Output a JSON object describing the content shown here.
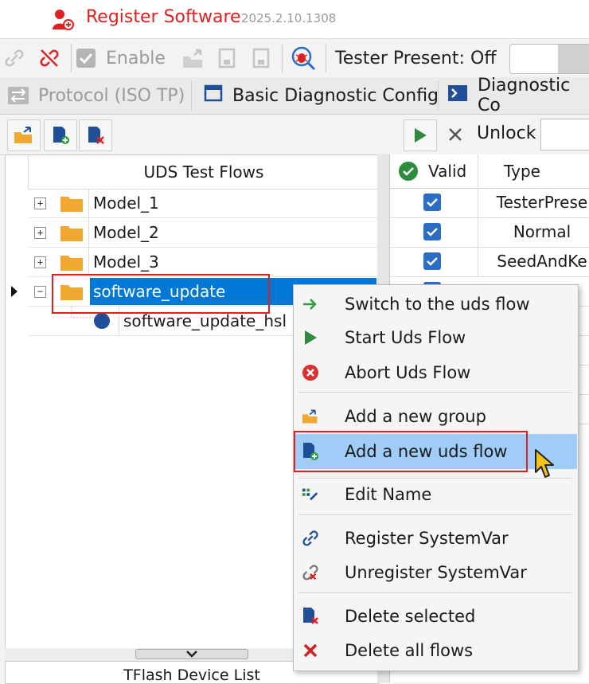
{
  "window": {
    "title": "Register Software",
    "version": "2025.2.10.1308"
  },
  "toolbar": {
    "enable_label": "Enable",
    "tester_present_label": "Tester Present:",
    "tester_present_value": "Off"
  },
  "tabs": [
    {
      "label": "Protocol (ISO TP)"
    },
    {
      "label": "Basic Diagnostic Config"
    },
    {
      "label": "Diagnostic Co"
    }
  ],
  "toolbar2": {
    "unlock_label": "Unlock"
  },
  "tree": {
    "header": "UDS Test Flows",
    "items": [
      {
        "label": "Model_1"
      },
      {
        "label": "Model_2"
      },
      {
        "label": "Model_3"
      },
      {
        "label": "software_update"
      },
      {
        "label": "software_update_hsl"
      }
    ]
  },
  "bottom_panel": {
    "header": "TFlash Device List"
  },
  "table": {
    "columns": [
      "Valid",
      "Type"
    ],
    "rows": [
      {
        "type": "TesterPrese"
      },
      {
        "type": "Normal"
      },
      {
        "type": "SeedAndKe"
      }
    ]
  },
  "context_menu": {
    "items": [
      {
        "label": "Switch to the uds flow",
        "icon": "arrow-right-icon"
      },
      {
        "label": "Start Uds Flow",
        "icon": "play-icon"
      },
      {
        "label": "Abort Uds Flow",
        "icon": "abort-icon"
      },
      {
        "label": "Add a new group",
        "icon": "folder-open-icon"
      },
      {
        "label": "Add a new uds flow",
        "icon": "doc-add-icon"
      },
      {
        "label": "Edit Name",
        "icon": "edit-icon"
      },
      {
        "label": "Register SystemVar",
        "icon": "link-icon"
      },
      {
        "label": "Unregister SystemVar",
        "icon": "unlink-icon"
      },
      {
        "label": "Delete selected",
        "icon": "doc-delete-icon"
      },
      {
        "label": "Delete all flows",
        "icon": "x-icon"
      }
    ]
  },
  "colors": {
    "accent_red": "#e02020",
    "selection_blue": "#0078d7",
    "menu_hover": "#9fcdf7",
    "checkbox_blue": "#2b6cc4",
    "play_green": "#2e8b3e"
  }
}
